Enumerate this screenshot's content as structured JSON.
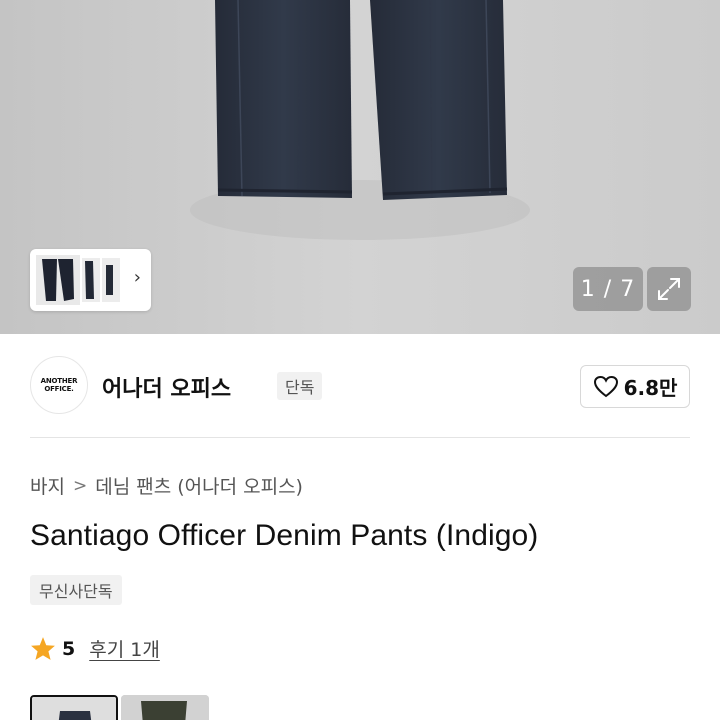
{
  "gallery": {
    "counter": "1 / 7",
    "next_thumb_icon": "chevron-right-icon",
    "expand_icon": "expand-icon"
  },
  "brand": {
    "logo_line1": "ANOTHER",
    "logo_line2": "OFFICE.",
    "name": "어나더 오피스",
    "badge": "단독",
    "like_icon": "heart-outline-icon",
    "like_count": "6.8만"
  },
  "breadcrumb": {
    "category": "바지",
    "separator": ">",
    "subcategory": "데님 팬츠 (어나더 오피스)"
  },
  "product": {
    "title": "Santiago Officer Denim Pants (Indigo)",
    "exclusive_badge": "무신사단독",
    "rating_icon": "star-icon",
    "rating_score": "5",
    "review_link": "후기 1개"
  },
  "colors": {
    "accent_star": "#f5a623",
    "pants": "#2a3140"
  }
}
